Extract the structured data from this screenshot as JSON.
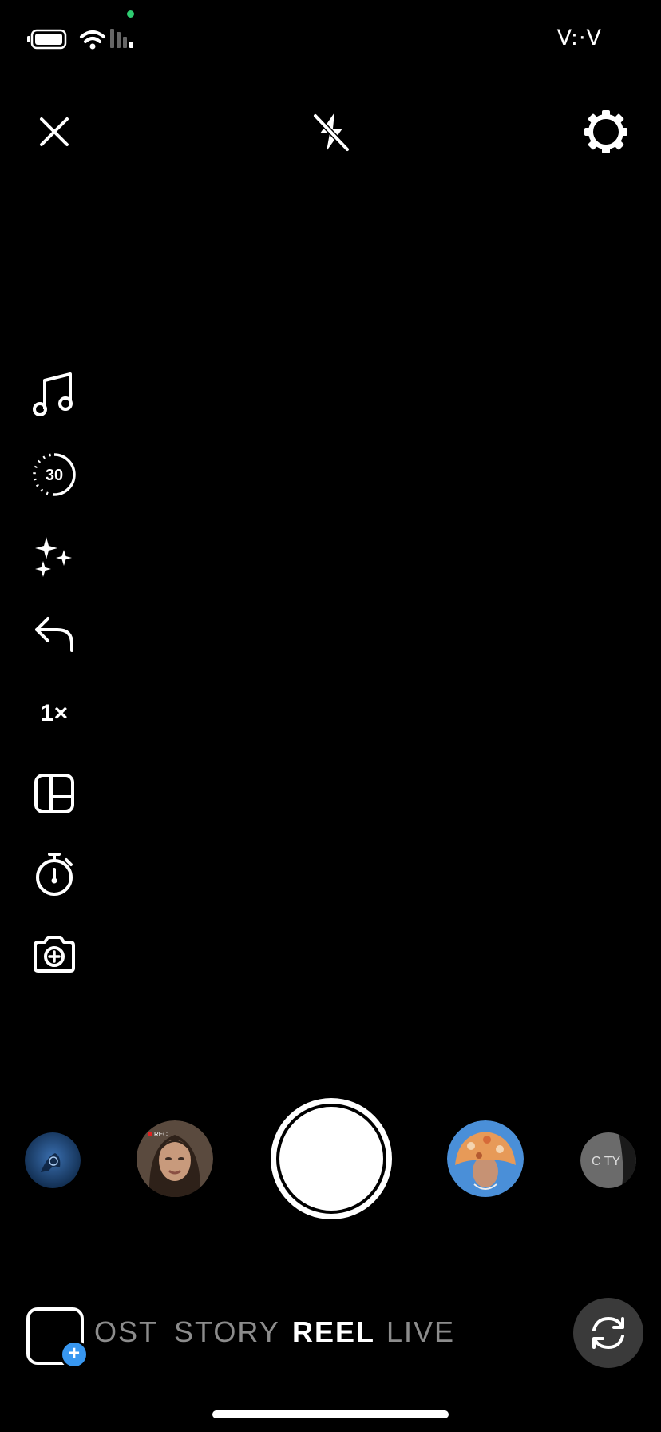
{
  "status_bar": {
    "time": "V:·V"
  },
  "top_controls": {
    "close": "close-icon",
    "flash": "flash-off-icon",
    "settings": "gear-icon"
  },
  "left_tools": {
    "music": "music-icon",
    "duration_label": "30",
    "effects": "sparkles-icon",
    "align": "reply-arrow-icon",
    "zoom_label": "1×",
    "layout": "layout-icon",
    "timer": "timer-icon",
    "dual_camera": "camera-plus-icon"
  },
  "effects_carousel": {
    "items": [
      "effect-1",
      "effect-2-rec",
      "effect-3-hat",
      "effect-4-city"
    ],
    "effect_2_badge": "REC",
    "effect_4_text": "C TY"
  },
  "modes": {
    "items": [
      "OST",
      "STORY",
      "REEL",
      "LIVE"
    ],
    "active": "REEL"
  },
  "colors": {
    "background": "#000000",
    "accent_blue": "#3897f0",
    "flip_button_bg": "#3a3a3a"
  }
}
